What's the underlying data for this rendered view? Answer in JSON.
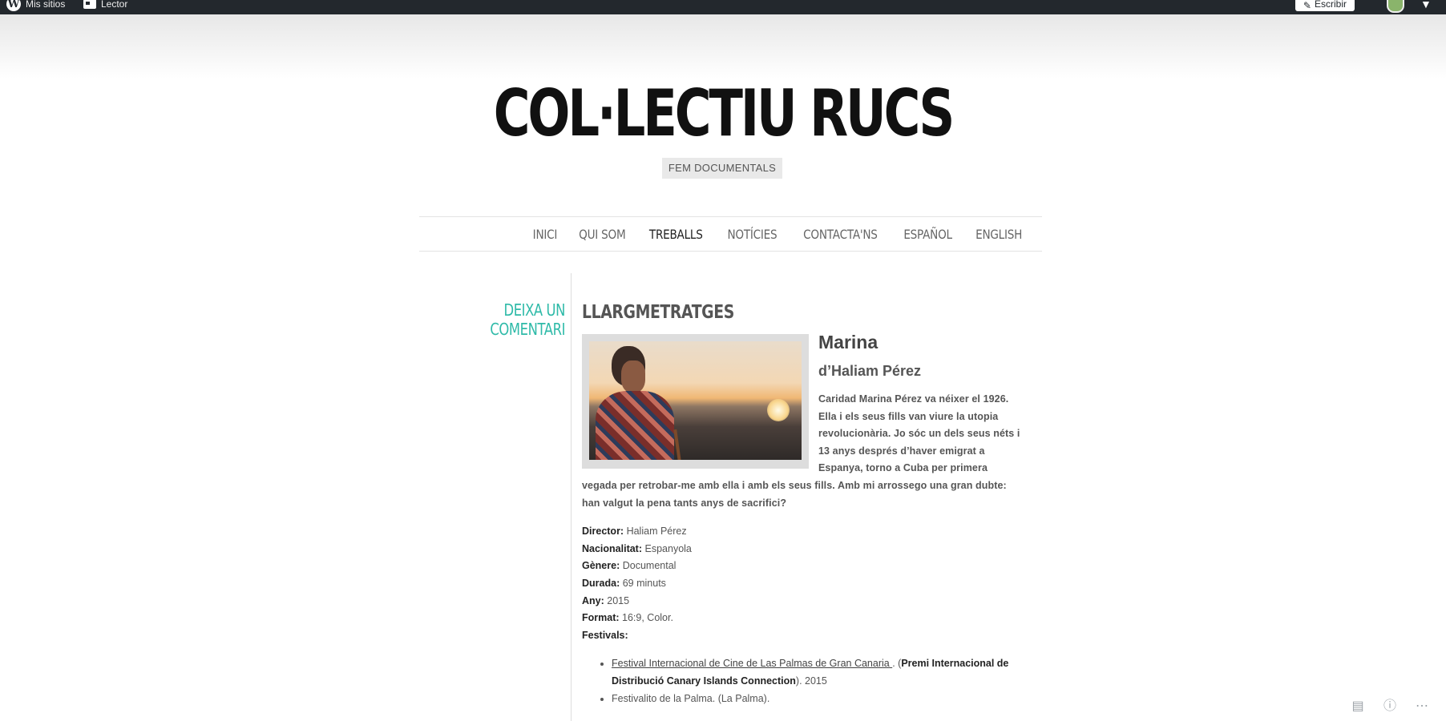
{
  "adminbar": {
    "my_sites": "Mis sitios",
    "reader": "Lector",
    "write": "Escribir"
  },
  "site": {
    "title": "COL·LECTIU RUCS",
    "tagline": "FEM DOCUMENTALS"
  },
  "nav": [
    {
      "label": "INICI"
    },
    {
      "label": "QUI SOM"
    },
    {
      "label": "TREBALLS",
      "active": true
    },
    {
      "label": "NOTÍCIES"
    },
    {
      "label": "CONTACTA'NS"
    },
    {
      "label": "ESPAÑOL"
    },
    {
      "label": "ENGLISH"
    }
  ],
  "sidebar": {
    "leave_comment": "DEIXA UN COMENTARI"
  },
  "post": {
    "title": "LLARGMETRATGES",
    "film_title": "Marina",
    "film_by": "d’Haliam Pérez",
    "synopsis": "Caridad Marina Pérez va néixer el 1926. Ella i els seus fills van viure la utopia revolucionària. Jo sóc un dels seus néts i 13 anys després d’haver emigrat a Espanya, torno a Cuba per primera vegada per retrobar-me amb ella i amb els seus fills. Amb mi arrossego una gran dubte: han valgut la pena tants anys de sacrifici?",
    "meta": {
      "director_label": "Director:",
      "director": "Haliam Pérez",
      "nationality_label": "Nacionalitat:",
      "nationality": "Espanyola",
      "genre_label": "Gènere:",
      "genre": "Documental",
      "duration_label": "Durada:",
      "duration": "69 minuts",
      "year_label": "Any:",
      "year": "2015",
      "format_label": "Format:",
      "format": "16:9, Color.",
      "festivals_label": "Festivals:"
    },
    "festivals": {
      "f1_link": "Festival Internacional de Cine de Las Palmas de Gran Canaria ",
      "f1_mid": ". (",
      "f1_award": "Premi Internacional de Distribució Canary Islands Connection",
      "f1_tail": ").  2015",
      "f2": "Festivalito de la Palma. (La Palma)."
    }
  },
  "colors": {
    "adminbar": "#23282d",
    "accent": "#2ebaa8"
  }
}
